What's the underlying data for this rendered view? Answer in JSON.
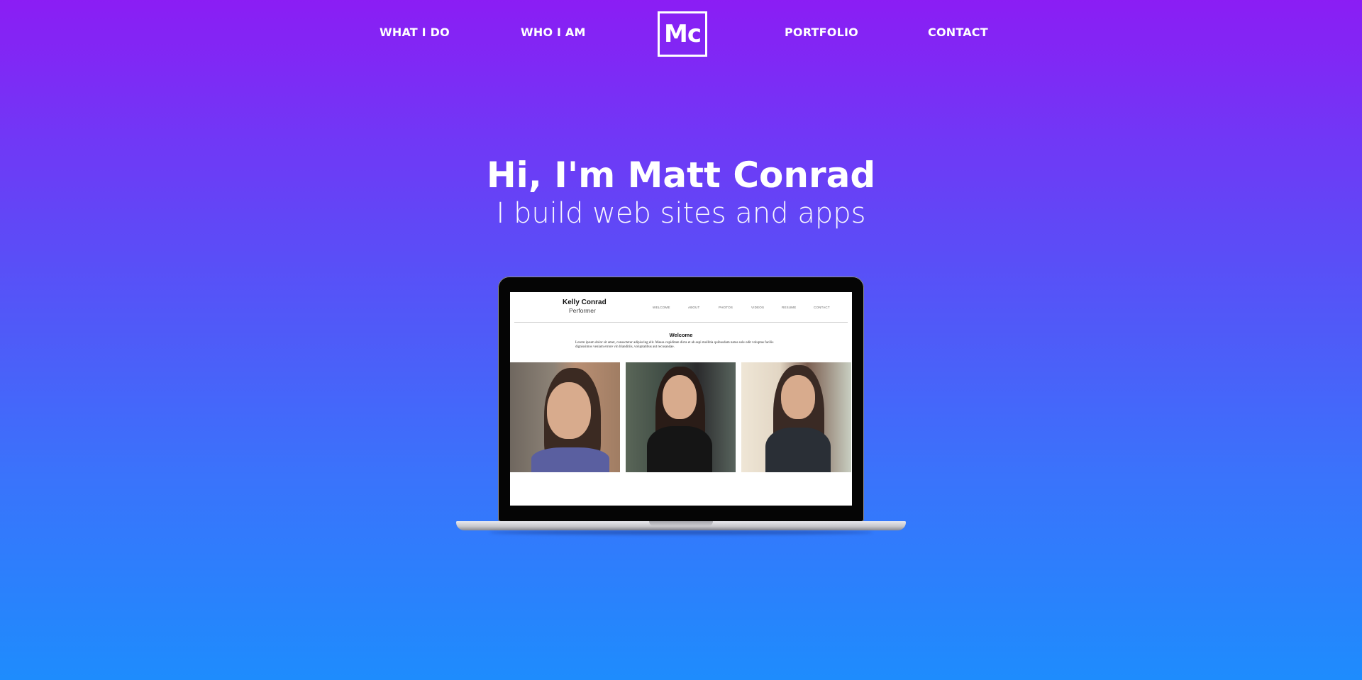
{
  "nav": {
    "items": [
      {
        "label": "WHAT I DO"
      },
      {
        "label": "WHO I AM"
      },
      {
        "label": "PORTFOLIO"
      },
      {
        "label": "CONTACT"
      }
    ],
    "logo_text": "Mc"
  },
  "hero": {
    "title": "Hi, I'm Matt Conrad",
    "subtitle": "I build web sites and apps"
  },
  "laptop_screen": {
    "site_name": "Kelly Conrad",
    "site_role": "Performer",
    "nav_items": [
      "WELCOME",
      "ABOUT",
      "PHOTOS",
      "VIDEOS",
      "RESUME",
      "CONTACT"
    ],
    "welcome_heading": "Welcome",
    "welcome_text": "Lorem ipsum dolor sit amet, consectetur adipiscing elit. Massa cupiditate dicta et ab aspi mollitia quibusdam natus sole odit voluptas facilis dignissimos veniam errore vin blanditiis, voluptatibus aut recusandae."
  },
  "colors": {
    "gradient_top": "#8b1df4",
    "gradient_bottom": "#1e8cfd",
    "text": "#ffffff"
  }
}
